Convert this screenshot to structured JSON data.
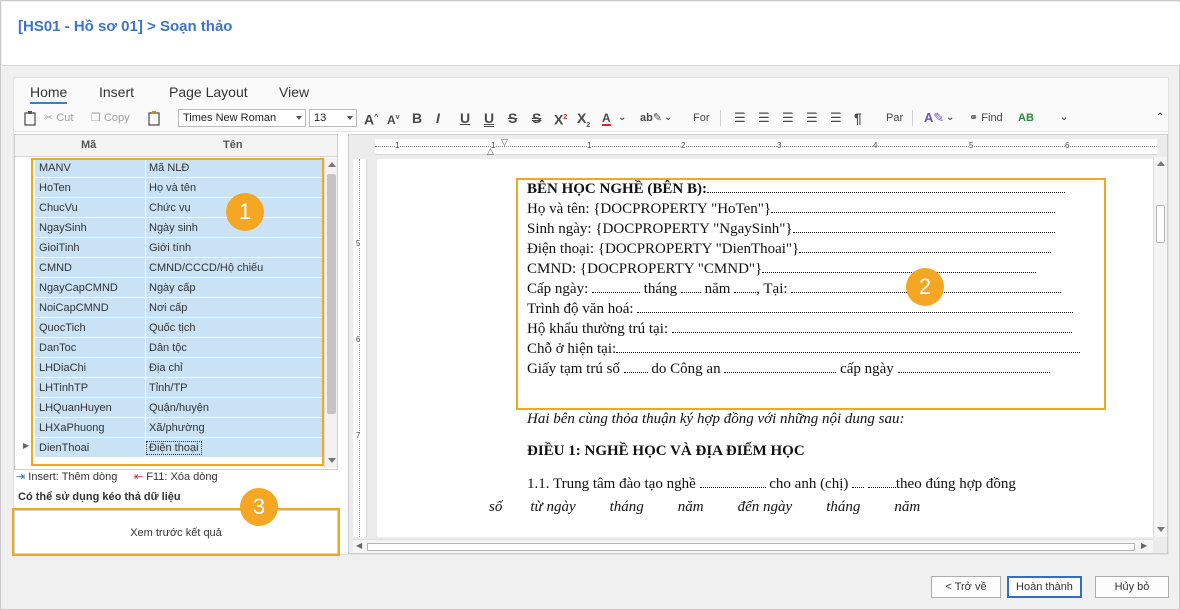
{
  "page_title": "[HS01 - Hồ sơ 01] > Soạn thảo",
  "ribbon": {
    "tabs": [
      "Home",
      "Insert",
      "Page Layout",
      "View"
    ],
    "cut": "Cut",
    "copy": "Copy",
    "font_name": "Times New Roman",
    "font_size": "13",
    "format_group": "For",
    "paragraph_group": "Par",
    "find": "Find"
  },
  "grid": {
    "col_ma": "Mã",
    "col_ten": "Tên",
    "rows": [
      {
        "ma": "MANV",
        "ten": "Mã NLĐ"
      },
      {
        "ma": "HoTen",
        "ten": "Họ và tên"
      },
      {
        "ma": "ChucVu",
        "ten": "Chức vụ"
      },
      {
        "ma": "NgaySinh",
        "ten": "Ngày sinh"
      },
      {
        "ma": "GioiTinh",
        "ten": "Giới tính"
      },
      {
        "ma": "CMND",
        "ten": "CMND/CCCD/Hộ chiếu"
      },
      {
        "ma": "NgayCapCMND",
        "ten": "Ngày cấp"
      },
      {
        "ma": "NoiCapCMND",
        "ten": "Nơi cấp"
      },
      {
        "ma": "QuocTich",
        "ten": "Quốc tịch"
      },
      {
        "ma": "DanToc",
        "ten": "Dân tộc"
      },
      {
        "ma": "LHDiaChi",
        "ten": "Địa chỉ"
      },
      {
        "ma": "LHTinhTP",
        "ten": "Tỉnh/TP"
      },
      {
        "ma": "LHQuanHuyen",
        "ten": "Quận/huyện"
      },
      {
        "ma": "LHXaPhuong",
        "ten": "Xã/phường"
      },
      {
        "ma": "DienThoai",
        "ten": "Điện thoại"
      }
    ]
  },
  "hints": {
    "insert": "Insert: Thêm dòng",
    "delete": "F11: Xóa dòng",
    "drag": "Có thể sử dụng kéo thả dữ liệu"
  },
  "preview_label": "Xem trước kết quả",
  "badges": [
    "1",
    "2",
    "3"
  ],
  "ruler_numbers": [
    "1",
    "2",
    "3",
    "4",
    "5",
    "6"
  ],
  "vruler_numbers": [
    "5",
    "6",
    "7"
  ],
  "document": {
    "heading": "BÊN HỌC NGHỀ (BÊN B):",
    "name_label": "Họ và tên: {DOCPROPERTY \"HoTen\"}",
    "dob_label": "Sinh ngày: {DOCPROPERTY \"NgaySinh\"}",
    "phone_label": "Điện thoại: {DOCPROPERTY \"DienThoai\"}",
    "id_label": "CMND: {DOCPROPERTY \"CMND\"}",
    "issue_a": "Cấp ngày:",
    "issue_b": "tháng",
    "issue_c": "năm",
    "issue_d": ", Tại:",
    "education": "Trình độ văn hoá:",
    "household": "Hộ khẩu thường trú tại:",
    "residence": "Chỗ ở hiện tại:",
    "temp_a": "Giấy tạm trú số",
    "temp_b": "do Công an",
    "temp_c": "cấp ngày",
    "agreement": "Hai bên cùng thỏa thuận ký hợp đồng với những nội dung sau:",
    "article1": "ĐIỀU 1: NGHỀ HỌC VÀ ĐỊA ĐIỂM HỌC",
    "clause_a": "1.1. Trung tâm đào tạo nghề",
    "clause_b": "cho anh (chị)",
    "clause_c": "theo đúng hợp đồng",
    "clause2_a": "số",
    "clause2_b": "từ ngày",
    "clause2_c": "tháng",
    "clause2_d": "năm",
    "clause2_e": "đến ngày",
    "clause2_f": "tháng",
    "clause2_g": "năm"
  },
  "footer": {
    "back": "< Trở về",
    "finish": "Hoàn thành",
    "cancel": "Hủy bỏ"
  },
  "colors": {
    "accent": "#3b74c9",
    "highlight": "#f0a91e",
    "badge": "#f5a623",
    "row_fill": "#c9e2f6"
  }
}
